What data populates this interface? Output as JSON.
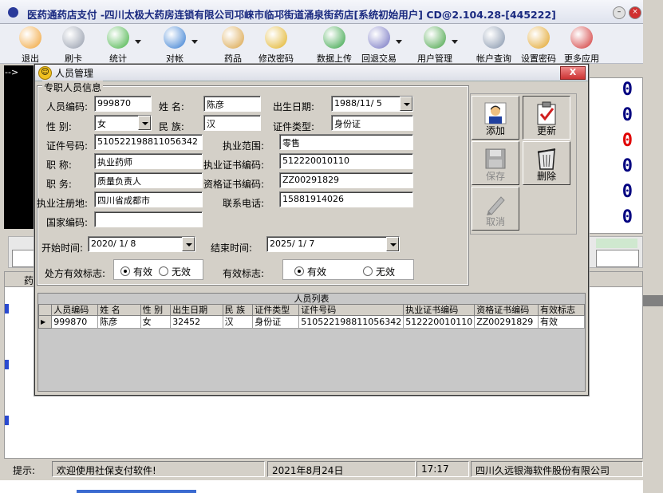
{
  "window": {
    "title": "医药通药店支付 -四川太极大药房连锁有限公司邛崃市临邛街道涌泉街药店[系统初始用户] CD@2.104.28-[445222]"
  },
  "toolbar": {
    "items": [
      {
        "label": "退出",
        "icon": "users-exit-icon",
        "color": "#f0a030"
      },
      {
        "label": "刷卡",
        "icon": "card-icon",
        "color": "#9098a8"
      },
      {
        "label": "统计",
        "icon": "pie-chart-icon",
        "color": "#40b040"
      },
      {
        "label": "对帐",
        "icon": "gear-icon",
        "color": "#3078d0"
      },
      {
        "label": "药品",
        "icon": "palette-icon",
        "color": "#d8a040"
      },
      {
        "label": "修改密码",
        "icon": "key-icon",
        "color": "#e0b020"
      },
      {
        "label": "数据上传",
        "icon": "upload-icon",
        "color": "#30a040"
      },
      {
        "label": "回退交易",
        "icon": "undo-icon",
        "color": "#7070c0"
      },
      {
        "label": "用户管理",
        "icon": "user-add-icon",
        "color": "#40a040"
      },
      {
        "label": "帐户查询",
        "icon": "magnifier-icon",
        "color": "#8090a8"
      },
      {
        "label": "设置密码",
        "icon": "lock-user-icon",
        "color": "#e0a020"
      },
      {
        "label": "更多应用",
        "icon": "wrench-icon",
        "color": "#d03030"
      }
    ]
  },
  "background": {
    "prompt_arrow": "-->",
    "counters": [
      "0",
      "0",
      "0",
      "0",
      "0",
      "0"
    ],
    "counter_colors": [
      "#000080",
      "#000080",
      "#e00000",
      "#000080",
      "#000080",
      "#000080"
    ],
    "table_header_fragment": "药"
  },
  "dialog": {
    "title": "人员管理",
    "close": "X",
    "group_label": "专职人员信息",
    "labels": {
      "staff_no": "人员编码:",
      "name": "姓    名:",
      "birth": "出生日期:",
      "gender": "性    别:",
      "ethnicity": "民    族:",
      "id_type": "证件类型:",
      "id_no": "证件号码:",
      "practice_scope": "执业范围:",
      "title": "职    称:",
      "practice_cert": "执业证书编码:",
      "position": "职    务:",
      "qual_cert": "资格证书编码:",
      "reg_place": "执业注册地:",
      "phone": "联系电话:",
      "country": "国家编码:",
      "start": "开始时间:",
      "end": "结束时间:",
      "rx_flag": "处方有效标志:",
      "valid_flag": "有效标志:"
    },
    "values": {
      "staff_no": "999870",
      "name": "陈彦",
      "birth": "1988/11/ 5",
      "gender": "女",
      "ethnicity": "汉",
      "id_type": "身份证",
      "id_no": "510522198811056342",
      "practice_scope": "零售",
      "title": "执业药师",
      "practice_cert": "512220010110",
      "position": "质量负责人",
      "qual_cert": "ZZ00291829",
      "reg_place": "四川省成都市",
      "phone": "15881914026",
      "country": "",
      "start": "2020/ 1/ 8",
      "end": "2025/ 1/ 7"
    },
    "radios": {
      "valid": "有效",
      "invalid": "无效"
    },
    "buttons": {
      "add": "添加",
      "update": "更新",
      "save": "保存",
      "delete": "删除",
      "cancel": "取消"
    },
    "grid": {
      "caption": "人员列表",
      "columns": [
        "人员编码",
        "姓  名",
        "性  别",
        "出生日期",
        "民  族",
        "证件类型",
        "证件号码",
        "执业证书编码",
        "资格证书编码",
        "有效标志"
      ],
      "rows": [
        [
          "999870",
          "陈彦",
          "女",
          "32452",
          "汉",
          "身份证",
          "510522198811056342",
          "512220010110",
          "ZZ00291829",
          "有效"
        ]
      ]
    }
  },
  "status": {
    "label": "提示:",
    "message": "欢迎使用社保支付软件!",
    "date": "2021年8月24日",
    "time": "17:17",
    "company": "四川久远银海软件股份有限公司"
  }
}
